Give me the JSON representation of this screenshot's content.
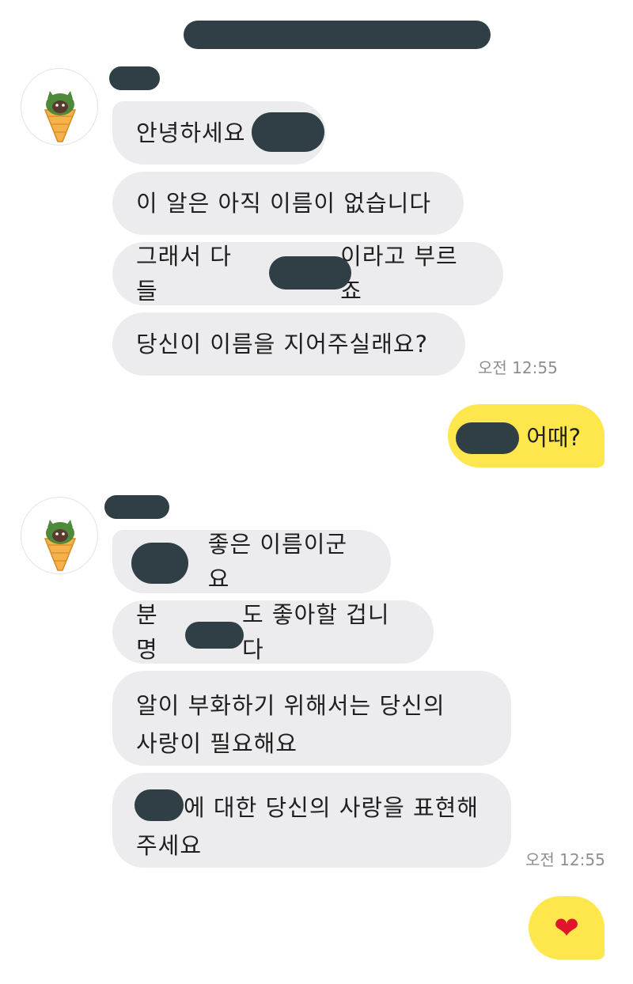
{
  "messages": {
    "group1": [
      {
        "text": "안녕하세요"
      },
      {
        "text": "이 알은 아직 이름이 없습니다"
      },
      {
        "text_a": "그래서 다들",
        "text_b": "이라고 부르죠"
      },
      {
        "text": "당신이 이름을 지어주실래요?"
      }
    ],
    "group1_time": "오전 12:55",
    "reply1": "어때?",
    "group2": [
      {
        "text": "좋은 이름이군요"
      },
      {
        "text_a": "분명",
        "text_b": "도 좋아할 겁니다"
      },
      {
        "line1": "알이 부화하기 위해서는 당신의",
        "line2": "사랑이 필요해요"
      },
      {
        "line1": "에 대한 당신의 사랑을 표현해",
        "line2": "주세요"
      }
    ],
    "group2_time": "오전 12:55",
    "reply2_icon": "heart-emoji"
  },
  "colors": {
    "incoming_bubble": "#ececee",
    "outgoing_bubble": "#fde74c",
    "redaction": "#2f3f45",
    "heart": "#e0142c"
  }
}
